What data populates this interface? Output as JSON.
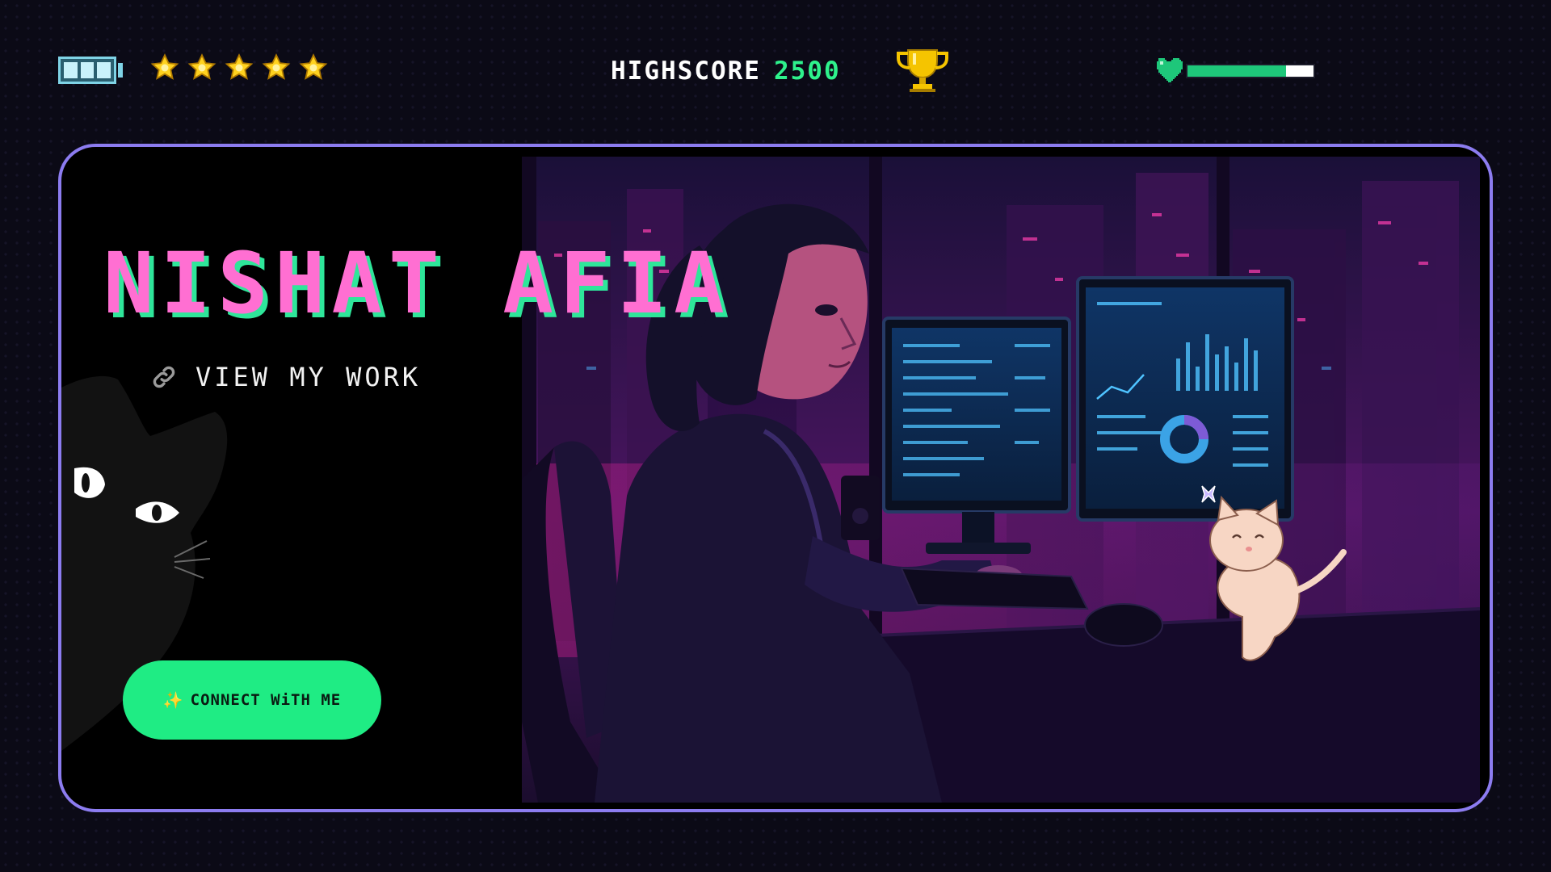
{
  "hud": {
    "battery_icon": "battery-icon",
    "battery_level": 1.0,
    "stars_count": 5,
    "star_icon": "star-icon",
    "highscore_label": "HIGHSCORE",
    "highscore_value": "2500",
    "trophy_icon": "trophy-icon",
    "health_icon": "pixel-heart-icon",
    "health_level": 0.78
  },
  "hero": {
    "name": "NISHAT AFIA",
    "view_work_label": "VIEW MY WORK",
    "view_work_icon": "link-icon",
    "connect_label": "CONNECT WiTH ME",
    "connect_icon": "sparkle-icon"
  },
  "colors": {
    "background": "#0b0a16",
    "card_border": "#8c7cf0",
    "name_pink": "#ff6fd2",
    "name_shadow_green": "#2ee69a",
    "button_green": "#1fec84",
    "score_green": "#2ef28c"
  }
}
